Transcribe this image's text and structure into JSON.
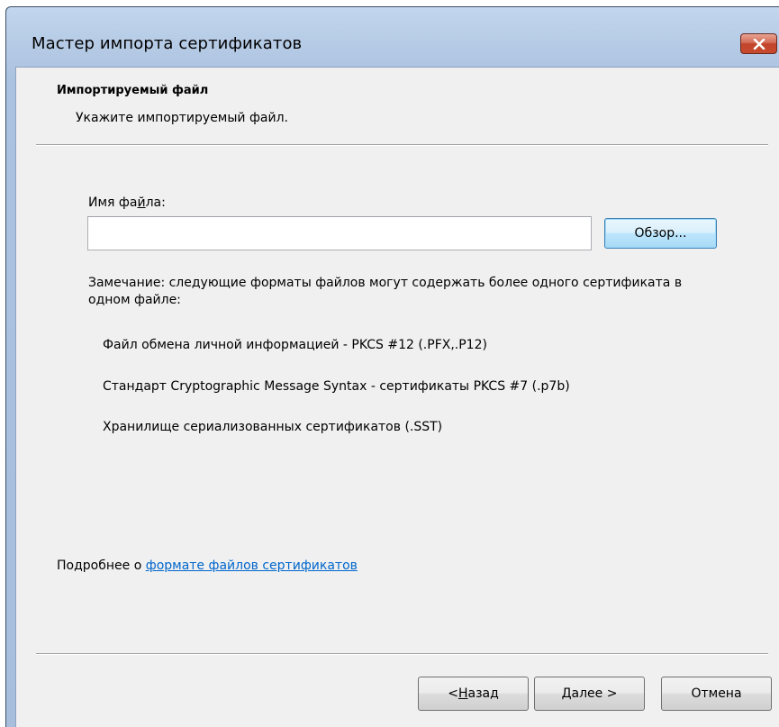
{
  "window": {
    "title": "Мастер импорта сертификатов"
  },
  "header": {
    "title": "Импортируемый файл",
    "subtitle": "Укажите импортируемый файл."
  },
  "file": {
    "label_pre": "Имя фа",
    "label_mnemonic": "й",
    "label_post": "ла:",
    "value": "",
    "placeholder": "",
    "browse_label": "Обзор..."
  },
  "note": {
    "text": "Замечание: следующие форматы файлов могут содержать более одного сертификата в одном файле:",
    "formats": [
      "Файл обмена личной информацией - PKCS #12 (.PFX,.P12)",
      "Стандарт Cryptographic Message Syntax - сертификаты PKCS #7 (.p7b)",
      "Хранилище сериализованных сертификатов (.SST)"
    ]
  },
  "more_info": {
    "prefix": "Подробнее о ",
    "link": "формате файлов сертификатов"
  },
  "buttons": {
    "back_pre": "< ",
    "back_mnemonic": "Н",
    "back_post": "азад",
    "next_mnemonic": "Д",
    "next_post": "алее >",
    "cancel": "Отмена"
  },
  "colors": {
    "link": "#0066cc",
    "close_button": "#c74a2f",
    "client_bg": "#f0f0f0"
  },
  "icons": {
    "close": "close-icon"
  }
}
